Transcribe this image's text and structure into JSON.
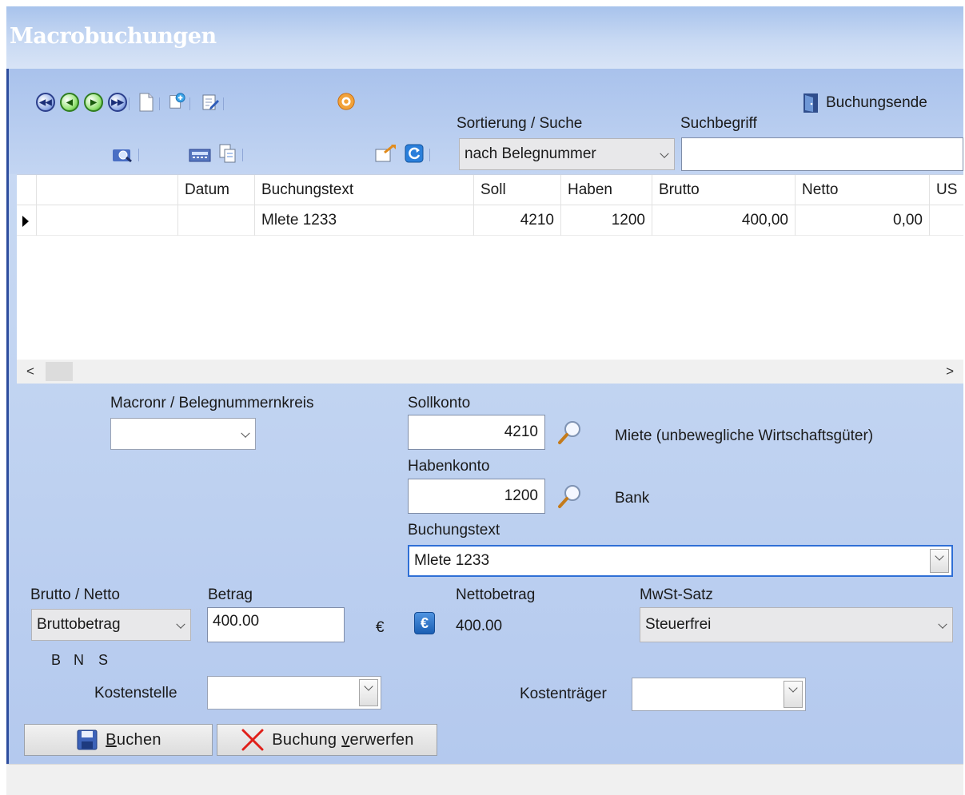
{
  "window": {
    "title": "Macrobuchungen"
  },
  "toolbar": {
    "end_label": "Buchungsende",
    "sort_label": "Sortierung / Suche",
    "sort_value": "nach Belegnummer",
    "search_label": "Suchbegriff",
    "search_value": ""
  },
  "grid": {
    "columns": [
      "",
      "Datum",
      "Buchungstext",
      "Soll",
      "Haben",
      "Brutto",
      "Netto",
      "US"
    ],
    "rows": [
      {
        "col1": "",
        "datum": "",
        "buchungstext": "Mlete 1233",
        "soll": "4210",
        "haben": "1200",
        "brutto": "400,00",
        "netto": "0,00",
        "us": ""
      }
    ]
  },
  "form": {
    "macronr_label": "Macronr / Belegnummernkreis",
    "macronr_value": "",
    "sollkonto_label": "Sollkonto",
    "sollkonto_value": "4210",
    "sollkonto_name": "Miete (unbewegliche Wirtschaftsgüter)",
    "habenkonto_label": "Habenkonto",
    "habenkonto_value": "1200",
    "habenkonto_name": "Bank",
    "buchungstext_label": "Buchungstext",
    "buchungstext_value": "Mlete 1233",
    "bruttonetto_label": "Brutto / Netto",
    "bruttonetto_value": "Bruttobetrag",
    "betrag_label": "Betrag",
    "betrag_value": "400.00",
    "currency_symbol": "€",
    "nettobetrag_label": "Nettobetrag",
    "nettobetrag_value": "400.00",
    "mwst_label": "MwSt-Satz",
    "mwst_value": "Steuerfrei",
    "bns_b": "B",
    "bns_n": "N",
    "bns_s": "S",
    "kostenstelle_label": "Kostenstelle",
    "kostenstelle_value": "",
    "kostentraeger_label": "Kostenträger",
    "kostentraeger_value": ""
  },
  "buttons": {
    "buchen_mnemonic": "B",
    "buchen_rest": "uchen",
    "verwerfen_prefix": "Buchung ",
    "verwerfen_mnemonic": "v",
    "verwerfen_rest": "erwerfen"
  },
  "colors": {
    "title_text": "#ffffff",
    "window_bg": "#c4d6f2",
    "titlebar_bg": "#b4cbef",
    "accent_blue": "#2d4d9e"
  }
}
